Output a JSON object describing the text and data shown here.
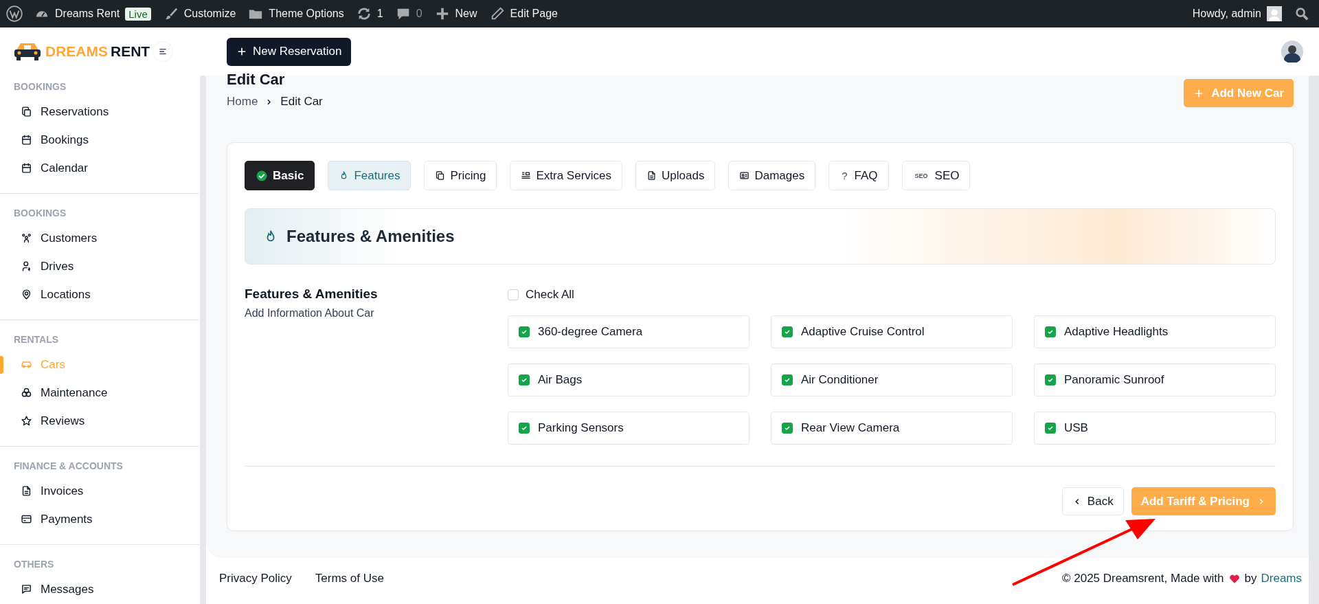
{
  "admin_bar": {
    "items": [
      {
        "kind": "site",
        "label": "Dreams Rent",
        "badge": "Live"
      },
      {
        "kind": "brush",
        "label": "Customize"
      },
      {
        "kind": "folder",
        "label": "Theme Options"
      },
      {
        "kind": "updates",
        "label": "1"
      },
      {
        "kind": "comments",
        "label": "0"
      },
      {
        "kind": "plus",
        "label": "New"
      },
      {
        "kind": "pencil",
        "label": "Edit Page"
      }
    ],
    "greeting": "Howdy, admin"
  },
  "logo": {
    "part_1": "DREAMS",
    "part_2": "RENT"
  },
  "header": {
    "new_button": "New Reservation"
  },
  "sidebar": {
    "sections": [
      {
        "title": "BOOKINGS",
        "items": [
          {
            "label": "Reservations",
            "selected": false
          },
          {
            "label": "Bookings",
            "selected": false
          },
          {
            "label": "Calendar",
            "selected": false
          }
        ]
      },
      {
        "title": "BOOKINGS",
        "items": [
          {
            "label": "Customers",
            "selected": false
          },
          {
            "label": "Drives",
            "selected": false
          },
          {
            "label": "Locations",
            "selected": false
          }
        ]
      },
      {
        "title": "RENTALS",
        "items": [
          {
            "label": "Cars",
            "selected": true
          },
          {
            "label": "Maintenance",
            "selected": false
          },
          {
            "label": "Reviews",
            "selected": false
          }
        ]
      },
      {
        "title": "FINANCE & ACCOUNTS",
        "items": [
          {
            "label": "Invoices",
            "selected": false
          },
          {
            "label": "Payments",
            "selected": false
          }
        ]
      },
      {
        "title": "OTHERS",
        "items": [
          {
            "label": "Messages",
            "selected": false
          }
        ]
      }
    ]
  },
  "page": {
    "title": "Edit Car",
    "breadcrumb": [
      "Home",
      "Edit Car"
    ],
    "add_button": "Add New Car"
  },
  "tabs": [
    {
      "label": "Basic",
      "selected": false,
      "completed": true
    },
    {
      "label": "Features",
      "selected": true,
      "completed": false
    },
    {
      "label": "Pricing",
      "selected": false,
      "completed": false
    },
    {
      "label": "Extra Services",
      "selected": false,
      "completed": false
    },
    {
      "label": "Uploads",
      "selected": false,
      "completed": false
    },
    {
      "label": "Damages",
      "selected": false,
      "completed": false
    },
    {
      "label": "FAQ",
      "selected": false,
      "completed": false,
      "glyph": "?"
    },
    {
      "label": "SEO",
      "selected": false,
      "completed": false,
      "glyph": "SEO"
    }
  ],
  "section": {
    "heading": "Features & Amenities",
    "label": "Features & Amenities",
    "description": "Add Information About Car",
    "check_all": {
      "label": "Check All",
      "checked": false
    },
    "features": [
      {
        "label": "360-degree Camera",
        "checked": true
      },
      {
        "label": "Adaptive Cruise Control",
        "checked": true
      },
      {
        "label": "Adaptive Headlights",
        "checked": true
      },
      {
        "label": "Air Bags",
        "checked": true
      },
      {
        "label": "Air Conditioner",
        "checked": true
      },
      {
        "label": "Panoramic Sunroof",
        "checked": true
      },
      {
        "label": "Parking Sensors",
        "checked": true
      },
      {
        "label": "Rear View Camera",
        "checked": true
      },
      {
        "label": "USB",
        "checked": true
      }
    ]
  },
  "actions": {
    "back": "Back",
    "next": "Add Tariff & Pricing"
  },
  "footer": {
    "links": [
      "Privacy Policy",
      "Terms of Use"
    ],
    "copyright": "© 2025 Dreamsrent, Made with",
    "by": "by",
    "author": "Dreams"
  }
}
